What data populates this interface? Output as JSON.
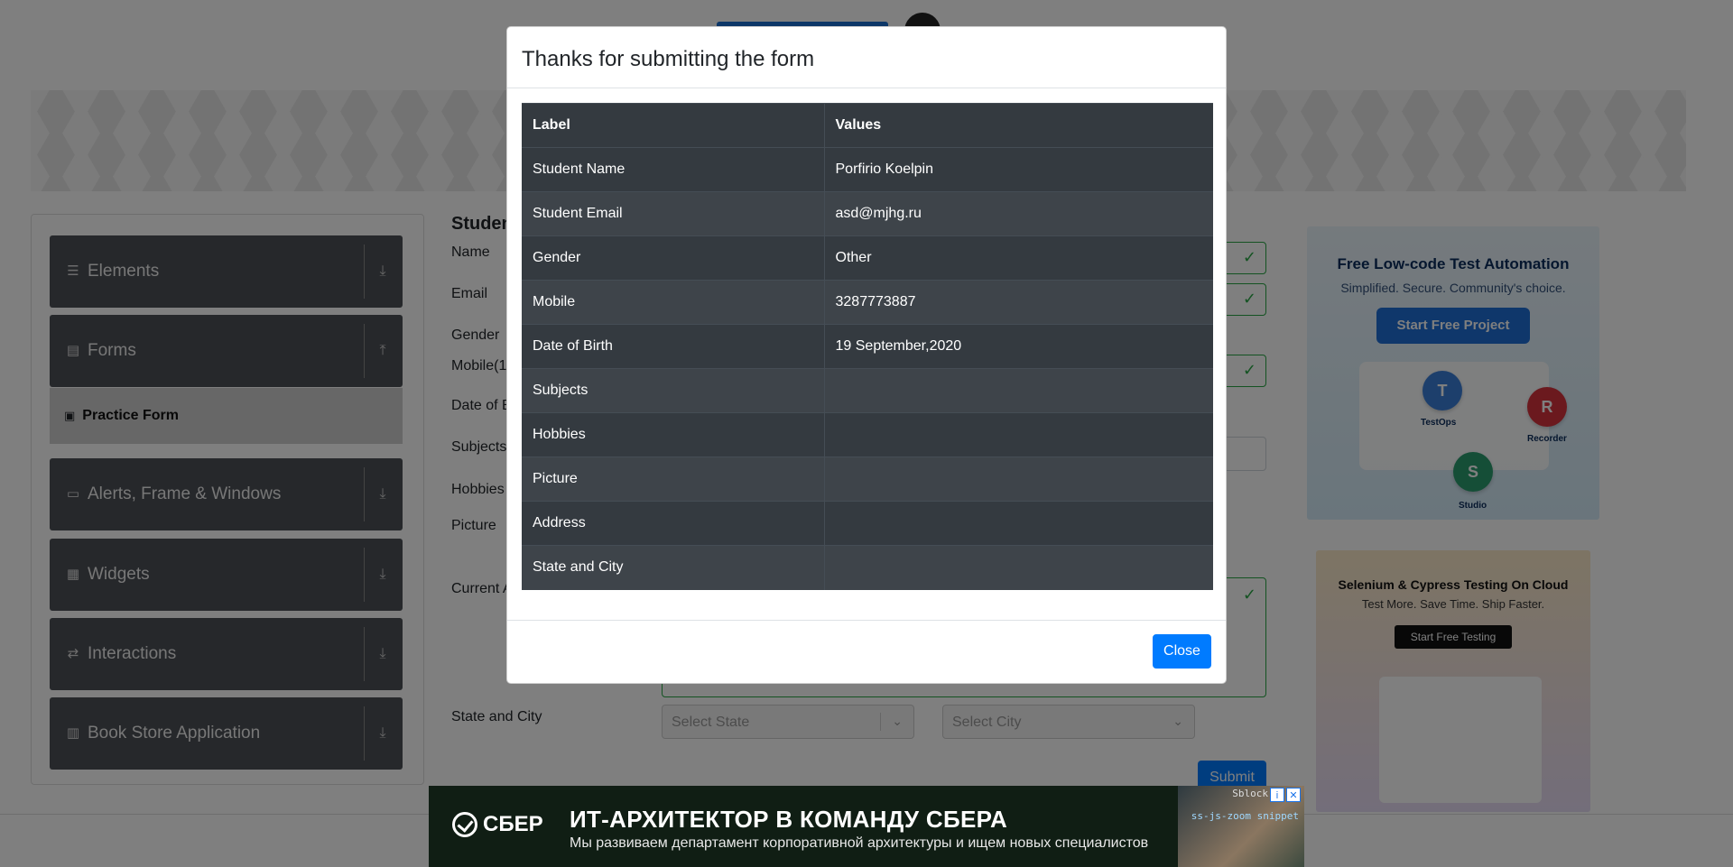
{
  "sidebar": {
    "groups": [
      {
        "label": "Elements",
        "icon": "list-icon"
      },
      {
        "label": "Forms",
        "icon": "document-icon"
      },
      {
        "label": "Alerts, Frame & Windows",
        "icon": "window-icon"
      },
      {
        "label": "Widgets",
        "icon": "grid-icon"
      },
      {
        "label": "Interactions",
        "icon": "swap-icon"
      },
      {
        "label": "Book Store Application",
        "icon": "books-icon"
      }
    ],
    "active_item": "Practice Form"
  },
  "form": {
    "title": "Studen",
    "labels": {
      "name": "Name",
      "email": "Email",
      "gender": "Gender",
      "mobile": "Mobile(1",
      "dob": "Date of B",
      "subjects": "Subjects",
      "hobbies": "Hobbies",
      "picture": "Picture",
      "address": "Current A",
      "state_city": "State and City"
    },
    "state_placeholder": "Select State",
    "city_placeholder": "Select City",
    "submit_label": "Submit"
  },
  "ads": {
    "katalon": {
      "headline": "Free Low-code Test Automation",
      "sub": "Simplified. Secure. Community's choice.",
      "cta": "Start Free Project",
      "tags": [
        "TestOps",
        "Recorder",
        "Studio"
      ]
    },
    "lambdatest": {
      "headline": "Selenium & Cypress Testing On Cloud",
      "sub": "Test More. Save Time. Ship Faster.",
      "cta": "Start Free Testing"
    },
    "sber": {
      "logo": "СБЕР",
      "headline": "ИТ-АРХИТЕКТОР В КОМАНДУ СБЕРА",
      "sub": "Мы развиваем департамент корпоративной архитектуры и ищем новых специалистов",
      "badge": "Sblock",
      "code": "ss-js-zoom snippet"
    }
  },
  "modal": {
    "title": "Thanks for submitting the form",
    "header": {
      "label": "Label",
      "value": "Values"
    },
    "rows": [
      {
        "label": "Student Name",
        "value": "Porfirio Koelpin"
      },
      {
        "label": "Student Email",
        "value": "asd@mjhg.ru"
      },
      {
        "label": "Gender",
        "value": "Other"
      },
      {
        "label": "Mobile",
        "value": "3287773887"
      },
      {
        "label": "Date of Birth",
        "value": "19 September,2020"
      },
      {
        "label": "Subjects",
        "value": ""
      },
      {
        "label": "Hobbies",
        "value": ""
      },
      {
        "label": "Picture",
        "value": ""
      },
      {
        "label": "Address",
        "value": ""
      },
      {
        "label": "State and City",
        "value": ""
      }
    ],
    "close_label": "Close"
  },
  "colors": {
    "primary": "#007bff",
    "table_dark": "#343a40",
    "valid": "#28a745",
    "sidebar": "#4d5157"
  }
}
